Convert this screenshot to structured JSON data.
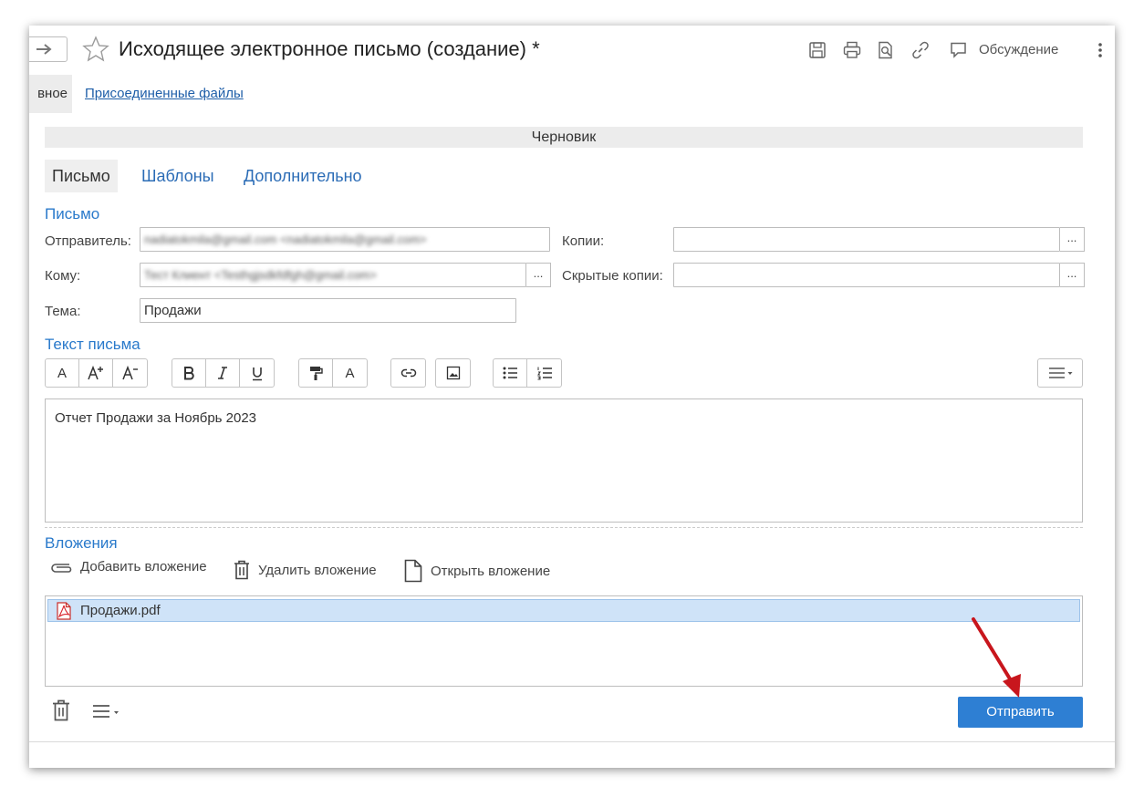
{
  "window": {
    "title": "Исходящее электронное письмо (создание) *",
    "discussion_label": "Обсуждение"
  },
  "form_tabs": {
    "main_partial": "вное",
    "attached_files": "Присоединенные файлы"
  },
  "status": "Черновик",
  "tabs": [
    {
      "label": "Письмо",
      "active": true
    },
    {
      "label": "Шаблоны",
      "active": false
    },
    {
      "label": "Дополнительно",
      "active": false
    }
  ],
  "letter": {
    "group_title": "Письмо",
    "sender_label": "Отправитель:",
    "sender_value": "nadiatokmila@gmail.com <nadiatokmila@gmail.com>",
    "to_label": "Кому:",
    "to_value": "Тест Клиент <Testhgjsdkfdfgh@gmail.com>",
    "subject_label": "Тема:",
    "subject_value": "Продажи",
    "cc_label": "Копии:",
    "cc_value": "",
    "bcc_label": "Скрытые копии:",
    "bcc_value": "",
    "select_button": "..."
  },
  "text": {
    "group_title": "Текст письма",
    "toolbar": {
      "font": "A",
      "color": "A"
    },
    "body": "Отчет Продажи за Ноябрь 2023"
  },
  "attachments": {
    "group_title": "Вложения",
    "add": "Добавить вложение",
    "delete": "Удалить вложение",
    "open": "Открыть вложение",
    "items": [
      {
        "name": "Продажи.pdf"
      }
    ]
  },
  "send_button": "Отправить",
  "colors": {
    "accent": "#2e7fd3",
    "link": "#1e5ea8",
    "group_title": "#2a7acb",
    "selection": "#cfe3f8",
    "arrow": "#c8161d"
  }
}
